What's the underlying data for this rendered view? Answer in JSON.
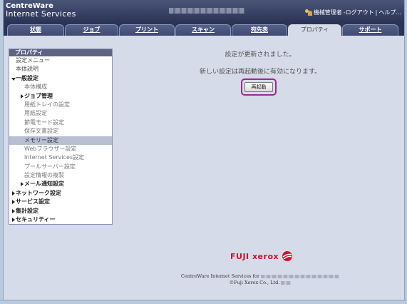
{
  "header": {
    "brand_line1": "CentreWare",
    "brand_line2": "Internet Services",
    "user_name": "機械管理者",
    "logout_label": "-ログアウト",
    "separator": "|",
    "help_label": "ヘルプ..."
  },
  "tabs": [
    {
      "label": "状態",
      "active": false
    },
    {
      "label": "ジョブ",
      "active": false
    },
    {
      "label": "プリント",
      "active": false
    },
    {
      "label": "スキャン",
      "active": false
    },
    {
      "label": "宛先表",
      "active": false
    },
    {
      "label": "プロパティ",
      "active": true
    },
    {
      "label": "サポート",
      "active": false
    }
  ],
  "menu": {
    "title": "プロパティ",
    "items": [
      {
        "label": "設定メニュー",
        "level": 0,
        "marker": "none",
        "bold": false,
        "selected": false
      },
      {
        "label": "本体説明",
        "level": 0,
        "marker": "none",
        "bold": false,
        "selected": false
      },
      {
        "label": "一般設定",
        "level": 0,
        "marker": "down",
        "bold": true,
        "selected": false
      },
      {
        "label": "本体構成",
        "level": 2,
        "marker": "none",
        "bold": false,
        "selected": false
      },
      {
        "label": "ジョブ管理",
        "level": 1,
        "marker": "right",
        "bold": true,
        "selected": false
      },
      {
        "label": "用紙トレイの設定",
        "level": 2,
        "marker": "none",
        "bold": false,
        "selected": false
      },
      {
        "label": "用紙設定",
        "level": 2,
        "marker": "none",
        "bold": false,
        "selected": false
      },
      {
        "label": "節電モード設定",
        "level": 2,
        "marker": "none",
        "bold": false,
        "selected": false
      },
      {
        "label": "保存文書設定",
        "level": 2,
        "marker": "none",
        "bold": false,
        "selected": false
      },
      {
        "label": "メモリー設定",
        "level": 2,
        "marker": "none",
        "bold": false,
        "selected": true
      },
      {
        "label": "Webブラウザー設定",
        "level": 2,
        "marker": "none",
        "bold": false,
        "selected": false
      },
      {
        "label": "Internet Services設定",
        "level": 2,
        "marker": "none",
        "bold": false,
        "selected": false
      },
      {
        "label": "プールサーバー設定",
        "level": 2,
        "marker": "none",
        "bold": false,
        "selected": false
      },
      {
        "label": "設定情報の複製",
        "level": 2,
        "marker": "none",
        "bold": false,
        "selected": false
      },
      {
        "label": "メール通知設定",
        "level": 1,
        "marker": "right",
        "bold": true,
        "selected": false
      },
      {
        "label": "ネットワーク設定",
        "level": 0,
        "marker": "right",
        "bold": true,
        "selected": false
      },
      {
        "label": "サービス設定",
        "level": 0,
        "marker": "right",
        "bold": true,
        "selected": false
      },
      {
        "label": "集計設定",
        "level": 0,
        "marker": "right",
        "bold": true,
        "selected": false
      },
      {
        "label": "セキュリティー",
        "level": 0,
        "marker": "right",
        "bold": true,
        "selected": false
      }
    ]
  },
  "main": {
    "message_updated": "設定が更新されました。",
    "message_restart": "新しい設定は再起動後に有効になります。",
    "restart_button": "再起動"
  },
  "footer": {
    "logo_text": "FUJI xerox",
    "line1_prefix": "CentreWare Internet Services for",
    "line2_prefix": "©Fuji Xerox Co., Ltd."
  },
  "colors": {
    "header_bg": "#2c3456",
    "content_bg": "#d5dbe8",
    "menu_title_bg": "#5d6383",
    "menu_selected_bg": "#b8bfd3",
    "restart_highlight": "#9c2a8e",
    "logo_red": "#d0102a"
  }
}
